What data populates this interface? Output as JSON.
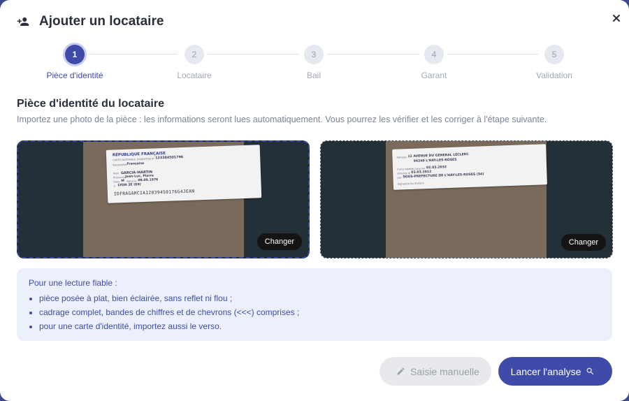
{
  "dialog": {
    "title": "Ajouter un locataire",
    "title_icon": "person-add-icon",
    "close_icon": "close-icon"
  },
  "stepper": {
    "active_step": 1,
    "steps": [
      {
        "number": "1",
        "label": "Pièce d'identité"
      },
      {
        "number": "2",
        "label": "Locataire"
      },
      {
        "number": "3",
        "label": "Bail"
      },
      {
        "number": "4",
        "label": "Garant"
      },
      {
        "number": "5",
        "label": "Validation"
      }
    ]
  },
  "section": {
    "title": "Pièce d'identité du locataire",
    "subtitle": "Importez une photo de la pièce : les informations seront lues automatiquement. Vous pourrez les vérifier et les corriger à l'étape suivante."
  },
  "uploads": {
    "front": {
      "change_label": "Changer",
      "card": {
        "line1": "RÉPUBLIQUE FRANÇAISE",
        "line2": "CARTE NATIONALE D'IDENTITÉ N°",
        "number": "123384501796",
        "nationality_label": "Nationalité",
        "nationality": "Française",
        "name_label": "Nom",
        "name": "GARCIA-MARTIN",
        "given_label": "Prénom(s)",
        "given": "Jean-Luc, Pierre",
        "sex_label": "Sexe",
        "sex": "M",
        "born_label": "Né(e) le",
        "born": "08.09.1976",
        "place_label": "à",
        "place": "LYON 3E (69)",
        "mrz": "IDFRAGARCIA12039450176G4JEAN"
      }
    },
    "back": {
      "change_label": "Changer",
      "card": {
        "address_label": "Adresse",
        "address1": "12 AVENUE DU GENERAL LECLERC",
        "address2": "94240 L'HAY-LES-ROSES",
        "valid_label": "Carte valable jusqu'au",
        "valid": "02.03.2032",
        "issued_label": "délivrée le",
        "issued": "03.03.2012",
        "by_label": "par",
        "by": "SOUS-PREFECTURE DE L'HAY-LES-ROSES (94)",
        "signature_label": "Signature du titulaire"
      }
    }
  },
  "tips": {
    "heading": "Pour une lecture fiable :",
    "items": [
      "pièce posée à plat, bien éclairée, sans reflet ni flou ;",
      "cadrage complet, bandes de chiffres et de chevrons (<<<) comprises ;",
      "pour une carte d'identité, importez aussi le verso."
    ]
  },
  "actions": {
    "manual_label": "Saisie manuelle",
    "manual_icon": "pencil-icon",
    "run_label": "Lancer l'analyse",
    "run_icon": "search-icon"
  },
  "colors": {
    "primary": "#3f4ba8",
    "tips_background": "#ecf0fb"
  }
}
